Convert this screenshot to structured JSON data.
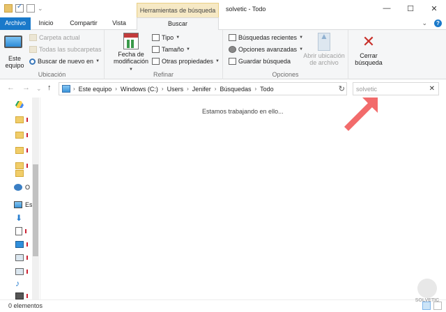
{
  "window": {
    "title": "solvetic - Todo",
    "context_tab_header": "Herramientas de búsqueda",
    "min": "—",
    "max": "☐",
    "close": "✕"
  },
  "tabs": {
    "file": "Archivo",
    "home": "Inicio",
    "share": "Compartir",
    "view": "Vista",
    "search": "Buscar",
    "expand": "⌄",
    "help": "?"
  },
  "ribbon": {
    "ubicacion": {
      "label": "Ubicación",
      "este_equipo": "Este equipo",
      "carpeta_actual": "Carpeta actual",
      "todas_subcarpetas": "Todas las subcarpetas",
      "buscar_de_nuevo": "Buscar de nuevo en"
    },
    "refinar": {
      "label": "Refinar",
      "fecha": "Fecha de modificación",
      "tipo": "Tipo",
      "tamano": "Tamaño",
      "otras": "Otras propiedades"
    },
    "opciones": {
      "label": "Opciones",
      "recientes": "Búsquedas recientes",
      "avanzadas": "Opciones avanzadas",
      "guardar": "Guardar búsqueda",
      "abrir_ubicacion": "Abrir ubicación de archivo"
    },
    "cerrar": {
      "label": "Cerrar búsqueda"
    }
  },
  "address": {
    "crumbs": [
      "Este equipo",
      "Windows (C:)",
      "Users",
      "Jenifer",
      "Búsquedas",
      "Todo"
    ],
    "separator": "›",
    "refresh": "↻"
  },
  "search": {
    "value": "solvetic",
    "clear": "✕"
  },
  "nav": {
    "back": "←",
    "forward": "→",
    "recent": "⌄",
    "up": "↑",
    "items": [
      {
        "icon": "drive-icon",
        "text": ""
      },
      {
        "icon": "folder-icon",
        "text": ""
      },
      {
        "icon": "folder-icon",
        "text": ""
      },
      {
        "icon": "folder-icon",
        "text": ""
      },
      {
        "icon": "folder-icon",
        "text": ""
      },
      {
        "icon": "folder-icon",
        "text": ""
      },
      {
        "icon": "network-icon",
        "text": "O"
      },
      {
        "icon": "pc-icon",
        "text": "Es"
      },
      {
        "icon": "download-icon",
        "text": ""
      },
      {
        "icon": "document-icon",
        "text": ""
      },
      {
        "icon": "desktop-icon",
        "text": ""
      },
      {
        "icon": "image-icon",
        "text": ""
      },
      {
        "icon": "image-icon",
        "text": ""
      },
      {
        "icon": "music-icon",
        "text": ""
      },
      {
        "icon": "video-icon",
        "text": ""
      }
    ]
  },
  "content": {
    "loading": "Estamos trabajando en ello..."
  },
  "status": {
    "count": "0 elementos"
  },
  "watermark": "SOLVETIC",
  "colors": {
    "file_tab": "#1979ca",
    "context_tab": "#f6e9c5",
    "close_x": "#c8302a",
    "arrow": "#f26b6b"
  }
}
